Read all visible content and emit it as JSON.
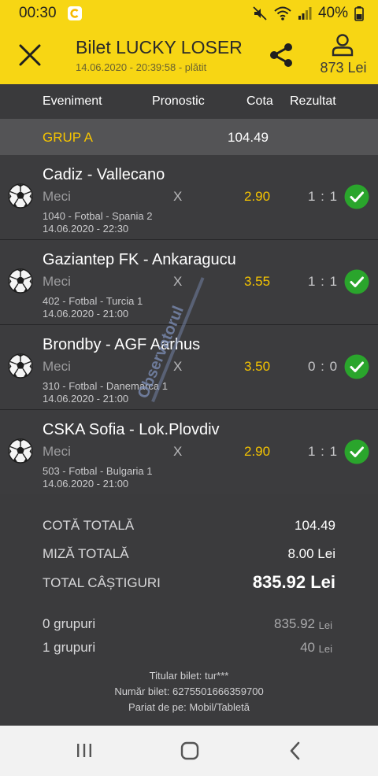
{
  "status_bar": {
    "time": "00:30",
    "battery": "40%",
    "icons": [
      "app-notification-icon",
      "mute-icon",
      "wifi-icon",
      "signal-icon",
      "battery-icon"
    ]
  },
  "header": {
    "title": "Bilet LUCKY LOSER",
    "subtitle": "14.06.2020 - 20:39:58 - plătit",
    "balance": "873 Lei",
    "icons": [
      "close-icon",
      "share-icon",
      "user-icon"
    ],
    "background_color": "#f7d614"
  },
  "table_header": {
    "event": "Eveniment",
    "pick": "Pronostic",
    "odds": "Cota",
    "result": "Rezultat"
  },
  "group": {
    "name": "GRUP A",
    "odds": "104.49"
  },
  "matches": [
    {
      "name": "Cadiz - Vallecano",
      "market": "Meci",
      "pick": "X",
      "odds": "2.90",
      "score": "1 : 1",
      "meta": "1040 - Fotbal - Spania 2",
      "date": "14.06.2020 - 22:30",
      "status": "won"
    },
    {
      "name": "Gaziantep FK - Ankaragucu",
      "market": "Meci",
      "pick": "X",
      "odds": "3.55",
      "score": "1 : 1",
      "meta": "402 - Fotbal - Turcia 1",
      "date": "14.06.2020 - 21:00",
      "status": "won"
    },
    {
      "name": "Brondby - AGF Aarhus",
      "market": "Meci",
      "pick": "X",
      "odds": "3.50",
      "score": "0 : 0",
      "meta": "310 - Fotbal - Danemarca 1",
      "date": "14.06.2020 - 21:00",
      "status": "won"
    },
    {
      "name": "CSKA Sofia - Lok.Plovdiv",
      "market": "Meci",
      "pick": "X",
      "odds": "2.90",
      "score": "1 : 1",
      "meta": "503 - Fotbal - Bulgaria 1",
      "date": "14.06.2020 - 21:00",
      "status": "won"
    }
  ],
  "totals": {
    "total_odds_label": "COTĂ TOTALĂ",
    "total_odds_value": "104.49",
    "total_stake_label": "MIZĂ TOTALĂ",
    "total_stake_value": "8.00 Lei",
    "total_win_label": "TOTAL CÂȘTIGURI",
    "total_win_value": "835.92 Lei"
  },
  "groups_summary": [
    {
      "label": "0 grupuri",
      "value": "835.92",
      "unit": "Lei"
    },
    {
      "label": "1 grupuri",
      "value": "40",
      "unit": "Lei"
    }
  ],
  "ticket_info": {
    "owner": "Titular bilet: tur***",
    "number": "Număr bilet: 6275501666359700",
    "placed_from": "Pariat de pe: Mobil/Tabletă"
  },
  "watermark": {
    "text": "Observatorul"
  },
  "nav_bar": {
    "icons": [
      "recent-apps-icon",
      "home-icon",
      "back-icon"
    ]
  },
  "colors": {
    "accent_yellow": "#f7d614",
    "odds_yellow": "#f5c400",
    "check_green": "#2aa52c",
    "background": "#3b3b3d"
  }
}
